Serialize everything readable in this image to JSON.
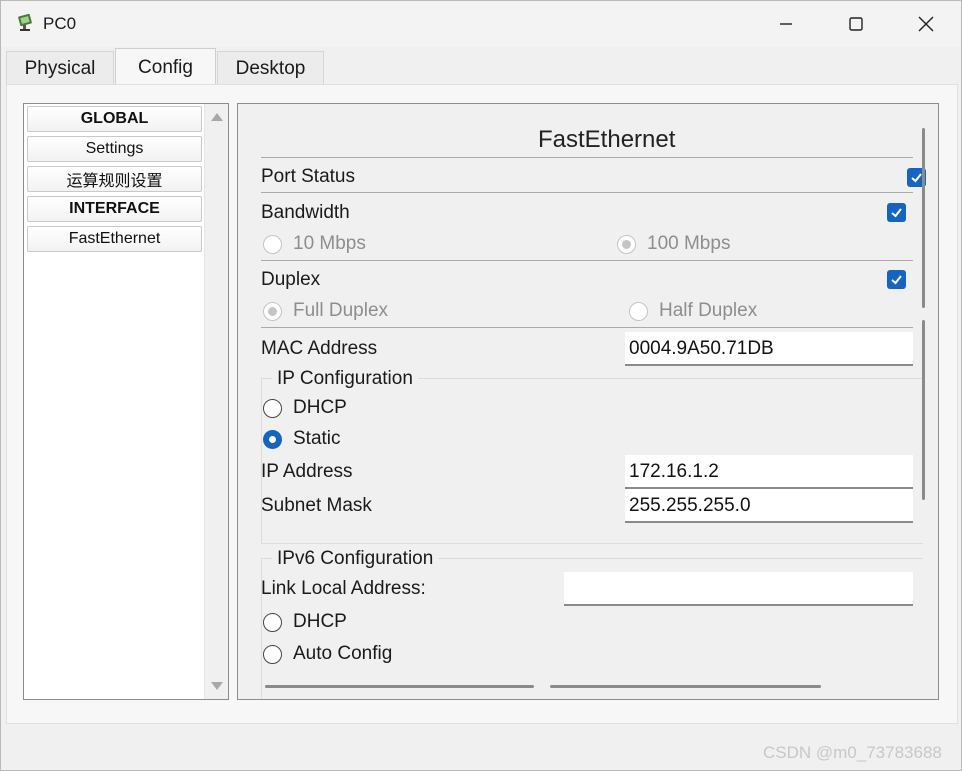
{
  "window": {
    "title": "PC0"
  },
  "tabs": [
    {
      "label": "Physical"
    },
    {
      "label": "Config"
    },
    {
      "label": "Desktop"
    }
  ],
  "sidebar": {
    "items": [
      {
        "label": "GLOBAL",
        "header": true
      },
      {
        "label": "Settings"
      },
      {
        "label": "运算规则设置"
      },
      {
        "label": "INTERFACE",
        "header": true
      },
      {
        "label": "FastEthernet"
      }
    ]
  },
  "panel": {
    "title": "FastEthernet",
    "port_status": {
      "label": "Port Status",
      "checked": true
    },
    "bandwidth": {
      "label": "Bandwidth",
      "auto_checked": true,
      "options": [
        "10 Mbps",
        "100 Mbps"
      ],
      "selected": "100 Mbps"
    },
    "duplex": {
      "label": "Duplex",
      "auto_checked": true,
      "options": [
        "Full Duplex",
        "Half Duplex"
      ],
      "selected": "Full Duplex"
    },
    "mac": {
      "label": "MAC Address",
      "value": "0004.9A50.71DB"
    },
    "ip_config": {
      "legend": "IP Configuration",
      "options": [
        "DHCP",
        "Static"
      ],
      "selected": "Static",
      "ip_label": "IP Address",
      "ip_value": "172.16.1.2",
      "mask_label": "Subnet Mask",
      "mask_value": "255.255.255.0"
    },
    "ipv6_config": {
      "legend": "IPv6 Configuration",
      "link_local_label": "Link Local Address:",
      "link_local_value": "",
      "options": [
        "DHCP",
        "Auto Config"
      ]
    }
  },
  "watermark": "CSDN @m0_73783688",
  "colors": {
    "accent": "#1565c0",
    "disabled_text": "#8e8e8e",
    "border": "#8c8c8c"
  }
}
